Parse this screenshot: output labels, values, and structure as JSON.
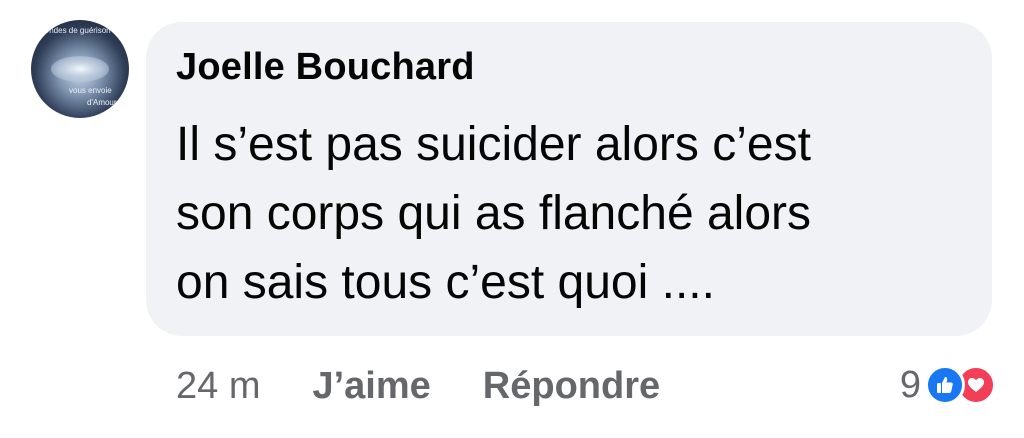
{
  "avatar": {
    "caption_top": "Ondes de guérison",
    "caption_bottom": "vous envoie",
    "caption_bottom2": "d'Amour"
  },
  "comment": {
    "author": "Joelle Bouchard",
    "message": "Il s’est pas suicider alors c’est\nson corps qui as flanché alors\non sais tous c’est quoi ...."
  },
  "actions": {
    "time": "24 m",
    "like_label": "J’aime",
    "reply_label": "Répondre"
  },
  "reactions": {
    "count": "9",
    "icons": [
      "like-icon",
      "love-icon"
    ],
    "like_color": "#1877f2",
    "love_color": "#f33e58"
  }
}
